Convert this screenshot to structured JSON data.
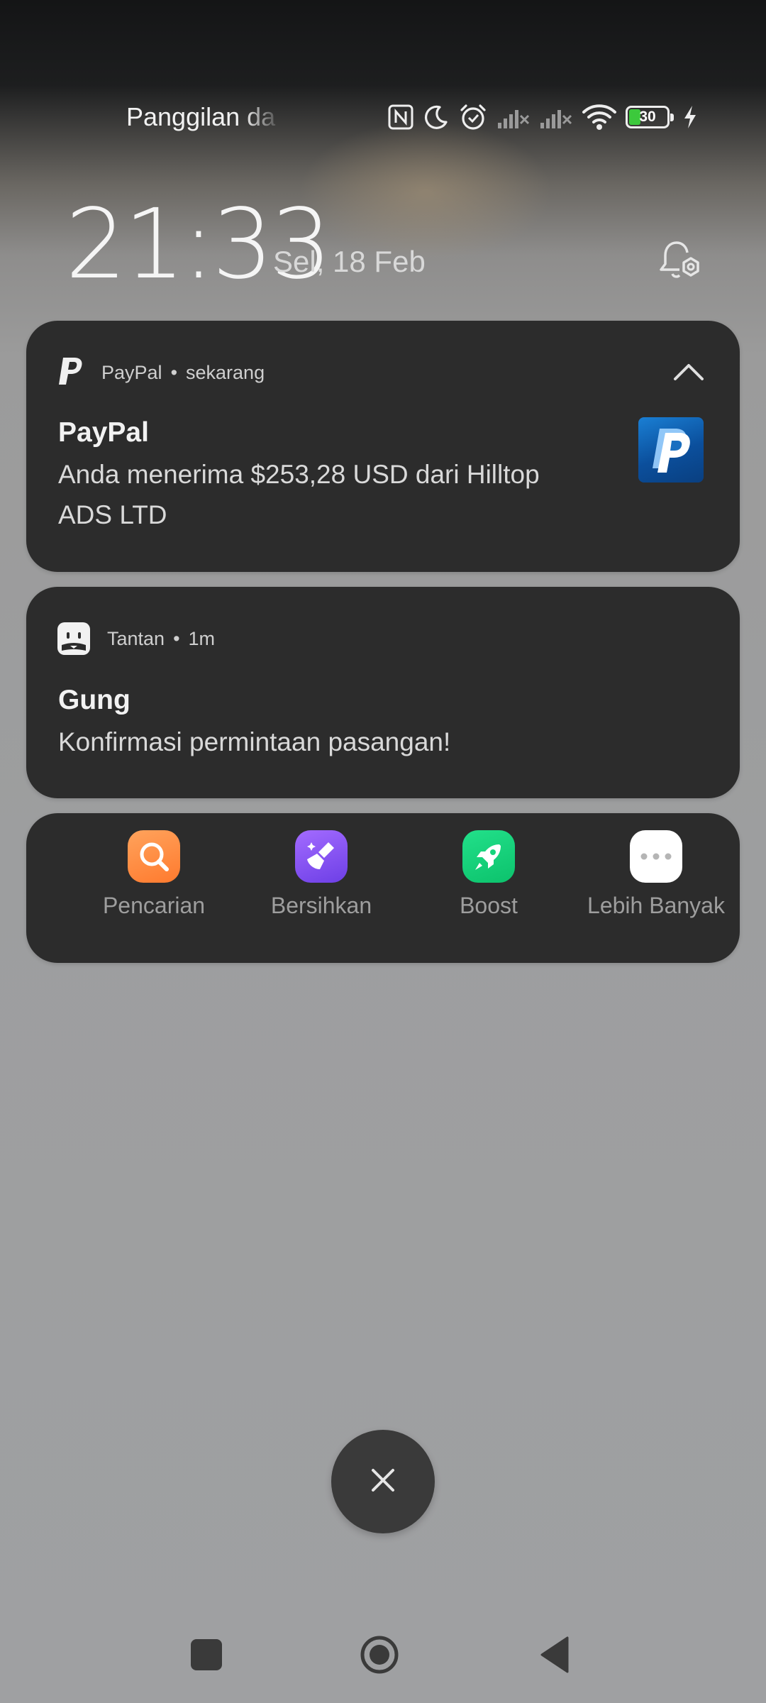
{
  "status_bar": {
    "carrier_text": "Panggilan da",
    "battery_level": "30",
    "icons": [
      "nfc-icon",
      "moon-icon",
      "alarm-icon",
      "signal-no-service-icon",
      "signal-no-service-icon",
      "wifi-icon",
      "battery-icon",
      "charging-icon"
    ]
  },
  "lockscreen": {
    "time": "21:33",
    "date": "Sel, 18 Feb"
  },
  "notifications": [
    {
      "app": "PayPal",
      "time": "sekarang",
      "title": "PayPal",
      "body_line1": "Anda menerima $253,28 USD dari Hilltop",
      "body_line2": "ADS LTD"
    },
    {
      "app": "Tantan",
      "time": "1m",
      "title": "Gung",
      "body": "Konfirmasi permintaan pasangan!"
    }
  ],
  "shortcuts": [
    {
      "label": "Pencarian",
      "icon": "search-icon",
      "color": "#ff8a3d"
    },
    {
      "label": "Bersihkan",
      "icon": "broom-icon",
      "color": "#8b5cf6"
    },
    {
      "label": "Boost",
      "icon": "rocket-icon",
      "color": "#16d47b"
    },
    {
      "label": "Lebih Banyak",
      "icon": "more-icon",
      "color": "#ffffff"
    }
  ],
  "separator": "•"
}
